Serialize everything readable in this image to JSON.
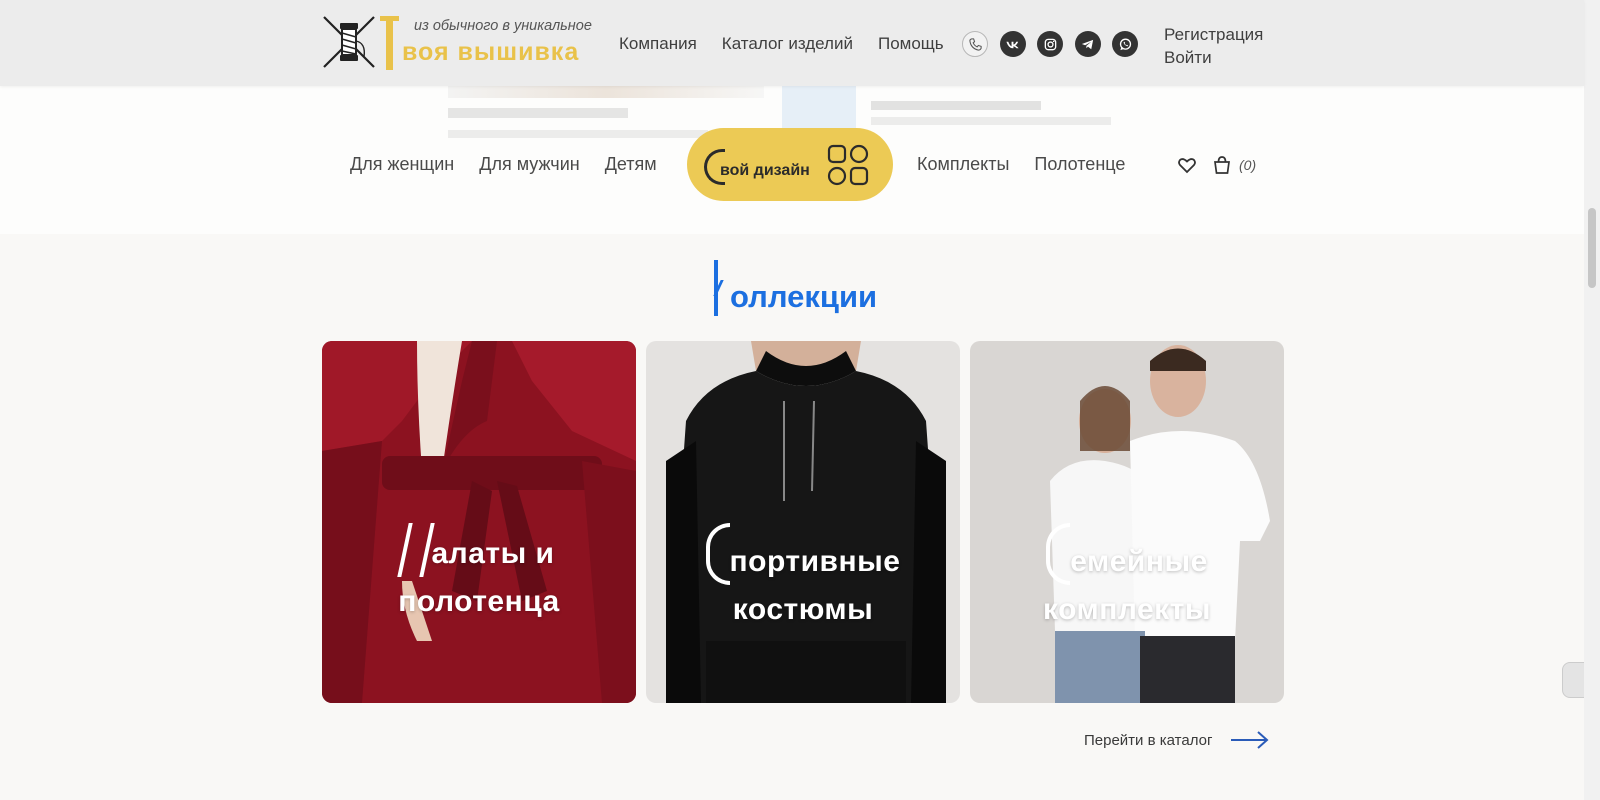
{
  "header": {
    "tagline": "из обычного в уникальное",
    "brand_rest": "воя вышивка",
    "nav": [
      "Компания",
      "Каталог изделий",
      "Помощь"
    ],
    "socials": [
      "phone-icon",
      "vk-icon",
      "instagram-icon",
      "telegram-icon",
      "whatsapp-icon"
    ],
    "register": "Регистрация",
    "login": "Войти"
  },
  "subnav": {
    "left": [
      "Для женщин",
      "Для мужчин",
      "Детям"
    ],
    "design_button": "вой дизайн",
    "right": [
      "Комплекты",
      "Полотенце"
    ],
    "cart_count": "(0)"
  },
  "collections": {
    "title_rest": "оллекции",
    "cards": [
      {
        "line1": "алаты и",
        "line2": "полотенца"
      },
      {
        "line1": "портивные",
        "line2": "костюмы"
      },
      {
        "line1": "емейные",
        "line2": "комплекты"
      }
    ],
    "catalog_link": "Перейти в каталог"
  },
  "colors": {
    "brand_yellow": "#e9c24a",
    "accent_blue": "#1c6fe0"
  }
}
